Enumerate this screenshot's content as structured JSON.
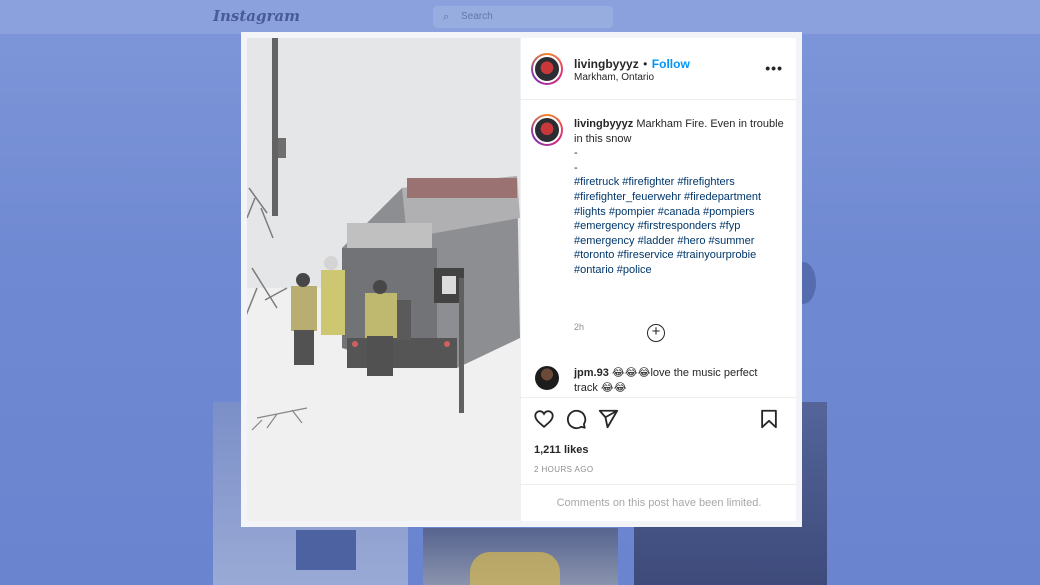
{
  "background": {
    "brand": "Instagram",
    "search_placeholder": "Search"
  },
  "post": {
    "username": "livingbyyyz",
    "separator": "•",
    "follow_label": "Follow",
    "location": "Markham, Ontario",
    "more_icon": "more-horizontal-icon",
    "caption_username": "livingbyyyz",
    "caption_text": "Markham Fire. Even in trouble in this snow",
    "caption_dash_1": "-",
    "caption_dash_2": "-",
    "hashtag_lines": [
      "#firetruck #firefighter #firefighters",
      "#firefighter_feuerwehr #firedepartment",
      "#lights #pompier #canada #pompiers",
      "#emergency #firstresponders #fyp",
      "#emergency #ladder #hero #summer",
      "#toronto #fireservice #trainyourprobie",
      "#ontario #police"
    ],
    "caption_time": "2h",
    "load_more_icon": "plus-circle-icon",
    "comment": {
      "username": "jpm.93",
      "emoji_1": "😂😂😂",
      "text": "love the music perfect track",
      "emoji_2": "😂😂"
    },
    "likes": "1,211 likes",
    "time_ago": "2 HOURS AGO",
    "comments_limited": "Comments on this post have been limited."
  },
  "colors": {
    "accent": "#0095f6",
    "hashtag": "#00376b",
    "muted": "#8e8e8e",
    "overlay_bg": "#6f89d2"
  }
}
